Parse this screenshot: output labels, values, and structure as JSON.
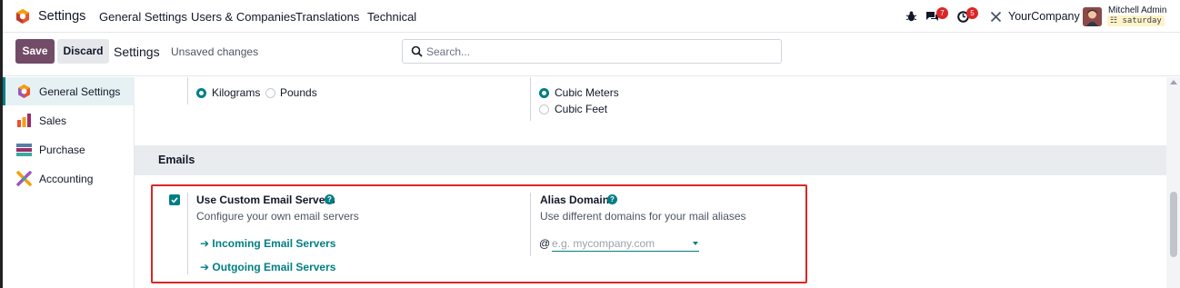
{
  "navbar": {
    "app_name": "Settings",
    "menu": [
      "General Settings",
      "Users & Companies",
      "Translations",
      "Technical"
    ],
    "messages_count": "7",
    "activities_count": "5",
    "company": "YourCompany",
    "user_name": "Mitchell Admin",
    "database": "saturday"
  },
  "control_panel": {
    "save_label": "Save",
    "discard_label": "Discard",
    "title": "Settings",
    "status": "Unsaved changes",
    "search_placeholder": "Search..."
  },
  "sidebar": {
    "items": [
      {
        "label": "General Settings",
        "icon": "settings-app-icon",
        "active": true
      },
      {
        "label": "Sales",
        "icon": "sales-app-icon",
        "active": false
      },
      {
        "label": "Purchase",
        "icon": "purchase-app-icon",
        "active": false
      },
      {
        "label": "Accounting",
        "icon": "accounting-app-icon",
        "active": false
      }
    ]
  },
  "units": {
    "weight": {
      "options": [
        "Kilograms",
        "Pounds"
      ],
      "selected": "Kilograms"
    },
    "volume": {
      "options": [
        "Cubic Meters",
        "Cubic Feet"
      ],
      "selected": "Cubic Meters"
    }
  },
  "emails": {
    "section_title": "Emails",
    "custom_servers": {
      "title": "Use Custom Email Servers",
      "description": "Configure your own email servers",
      "checked": true,
      "incoming_link": "Incoming Email Servers",
      "outgoing_link": "Outgoing Email Servers",
      "arrow": "➔"
    },
    "alias_domain": {
      "title": "Alias Domain",
      "description": "Use different domains for your mail aliases",
      "prefix": "@",
      "placeholder": "e.g. mycompany.com"
    }
  },
  "colors": {
    "brand": "#714b67",
    "accent": "#017e84",
    "badge": "#dc2626",
    "highlight_box": "#dc2626"
  }
}
